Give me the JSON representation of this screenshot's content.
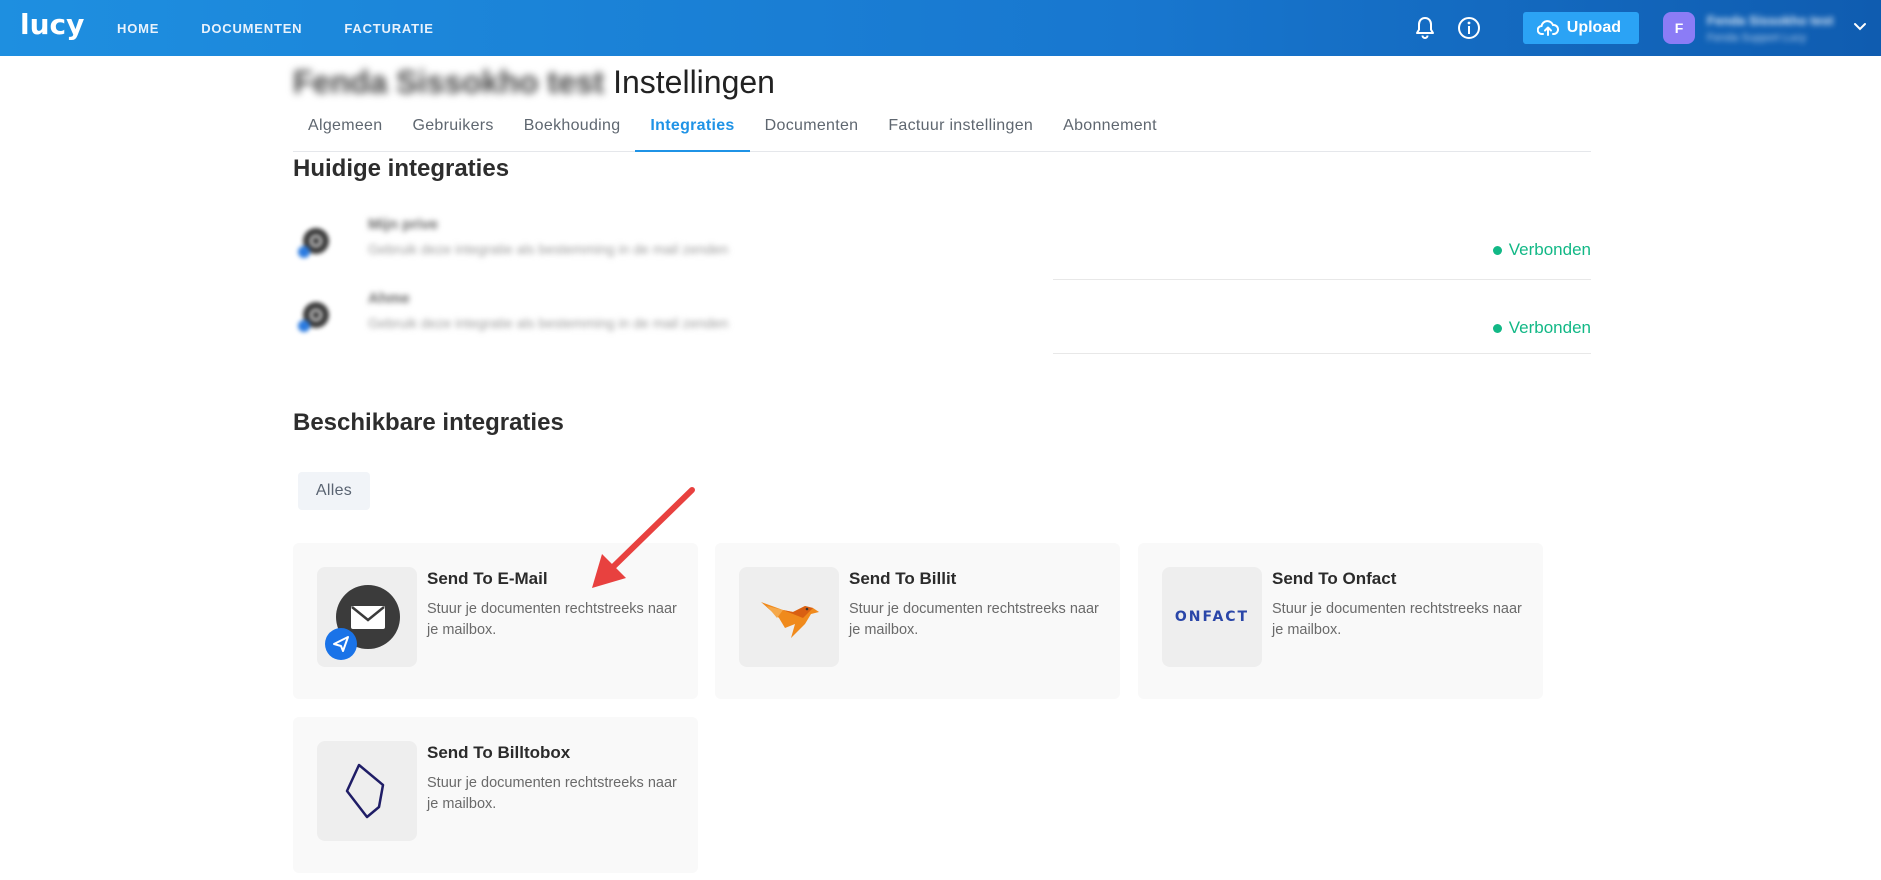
{
  "app": {
    "logo": "lucy",
    "nav": [
      "HOME",
      "DOCUMENTEN",
      "FACTURATIE"
    ],
    "upload_label": "Upload",
    "avatar_initial": "F",
    "user_name": "Fenda Sissokho test",
    "user_sub": "Fenda Support Lucy"
  },
  "page": {
    "company": "Fenda Sissokho test",
    "title": "Instellingen",
    "tabs": [
      "Algemeen",
      "Gebruikers",
      "Boekhouding",
      "Integraties",
      "Documenten",
      "Factuur instellingen",
      "Abonnement"
    ],
    "active_tab": "Integraties"
  },
  "current": {
    "title": "Huidige integraties",
    "items": [
      {
        "name": "Mijn prive",
        "desc": "Gebruik deze integratie als bestemming in de mail zenden",
        "status": "Verbonden"
      },
      {
        "name": "Ahme",
        "desc": "Gebruik deze integratie als bestemming in de mail zenden",
        "status": "Verbonden"
      }
    ]
  },
  "available": {
    "title": "Beschikbare integraties",
    "filter": "Alles",
    "cards": [
      {
        "title": "Send To E-Mail",
        "desc": "Stuur je documenten rechtstreeks naar je mailbox."
      },
      {
        "title": "Send To Billit",
        "desc": "Stuur je documenten rechtstreeks naar je mailbox."
      },
      {
        "title": "Send To Onfact",
        "desc": "Stuur je documenten rechtstreeks naar je mailbox.",
        "logo_text": "ONFACT"
      },
      {
        "title": "Send To Billtobox",
        "desc": "Stuur je documenten rechtstreeks naar je mailbox."
      }
    ]
  },
  "colors": {
    "accent": "#1f93e6",
    "connected": "#12b886",
    "annotation_arrow": "#e8413f"
  }
}
